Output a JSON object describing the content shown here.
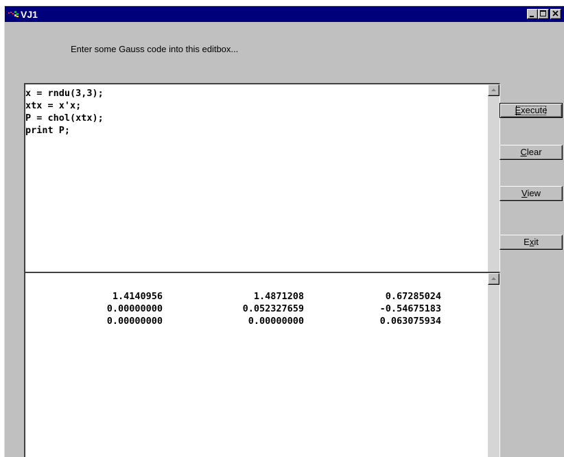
{
  "window": {
    "title": "VJ1",
    "controls": {
      "minimize_icon": "minimize-icon",
      "maximize_icon": "maximize-icon",
      "close_icon": "close-icon"
    }
  },
  "instruction": "Enter some Gauss code into this editbox...",
  "code": {
    "lines": [
      "x = rndu(3,3);",
      "xtx = x'x;",
      "P = chol(xtx);",
      "print P;"
    ]
  },
  "output": {
    "rows": [
      [
        "1.4140956",
        "1.4871208",
        "0.67285024"
      ],
      [
        "0.00000000",
        "0.052327659",
        "-0.54675183"
      ],
      [
        "0.00000000",
        "0.00000000",
        "0.063075934"
      ]
    ]
  },
  "buttons": {
    "execute": {
      "mnemonic": "E",
      "rest": "xecute"
    },
    "clear": {
      "mnemonic": "C",
      "rest": "lear"
    },
    "view": {
      "mnemonic": "V",
      "rest": "iew"
    },
    "exit": {
      "pre": "E",
      "mnemonic": "x",
      "rest": "it"
    }
  },
  "colors": {
    "titlebar": "#00007b",
    "face": "#c0c0c0",
    "editbox": "#ffffff"
  }
}
